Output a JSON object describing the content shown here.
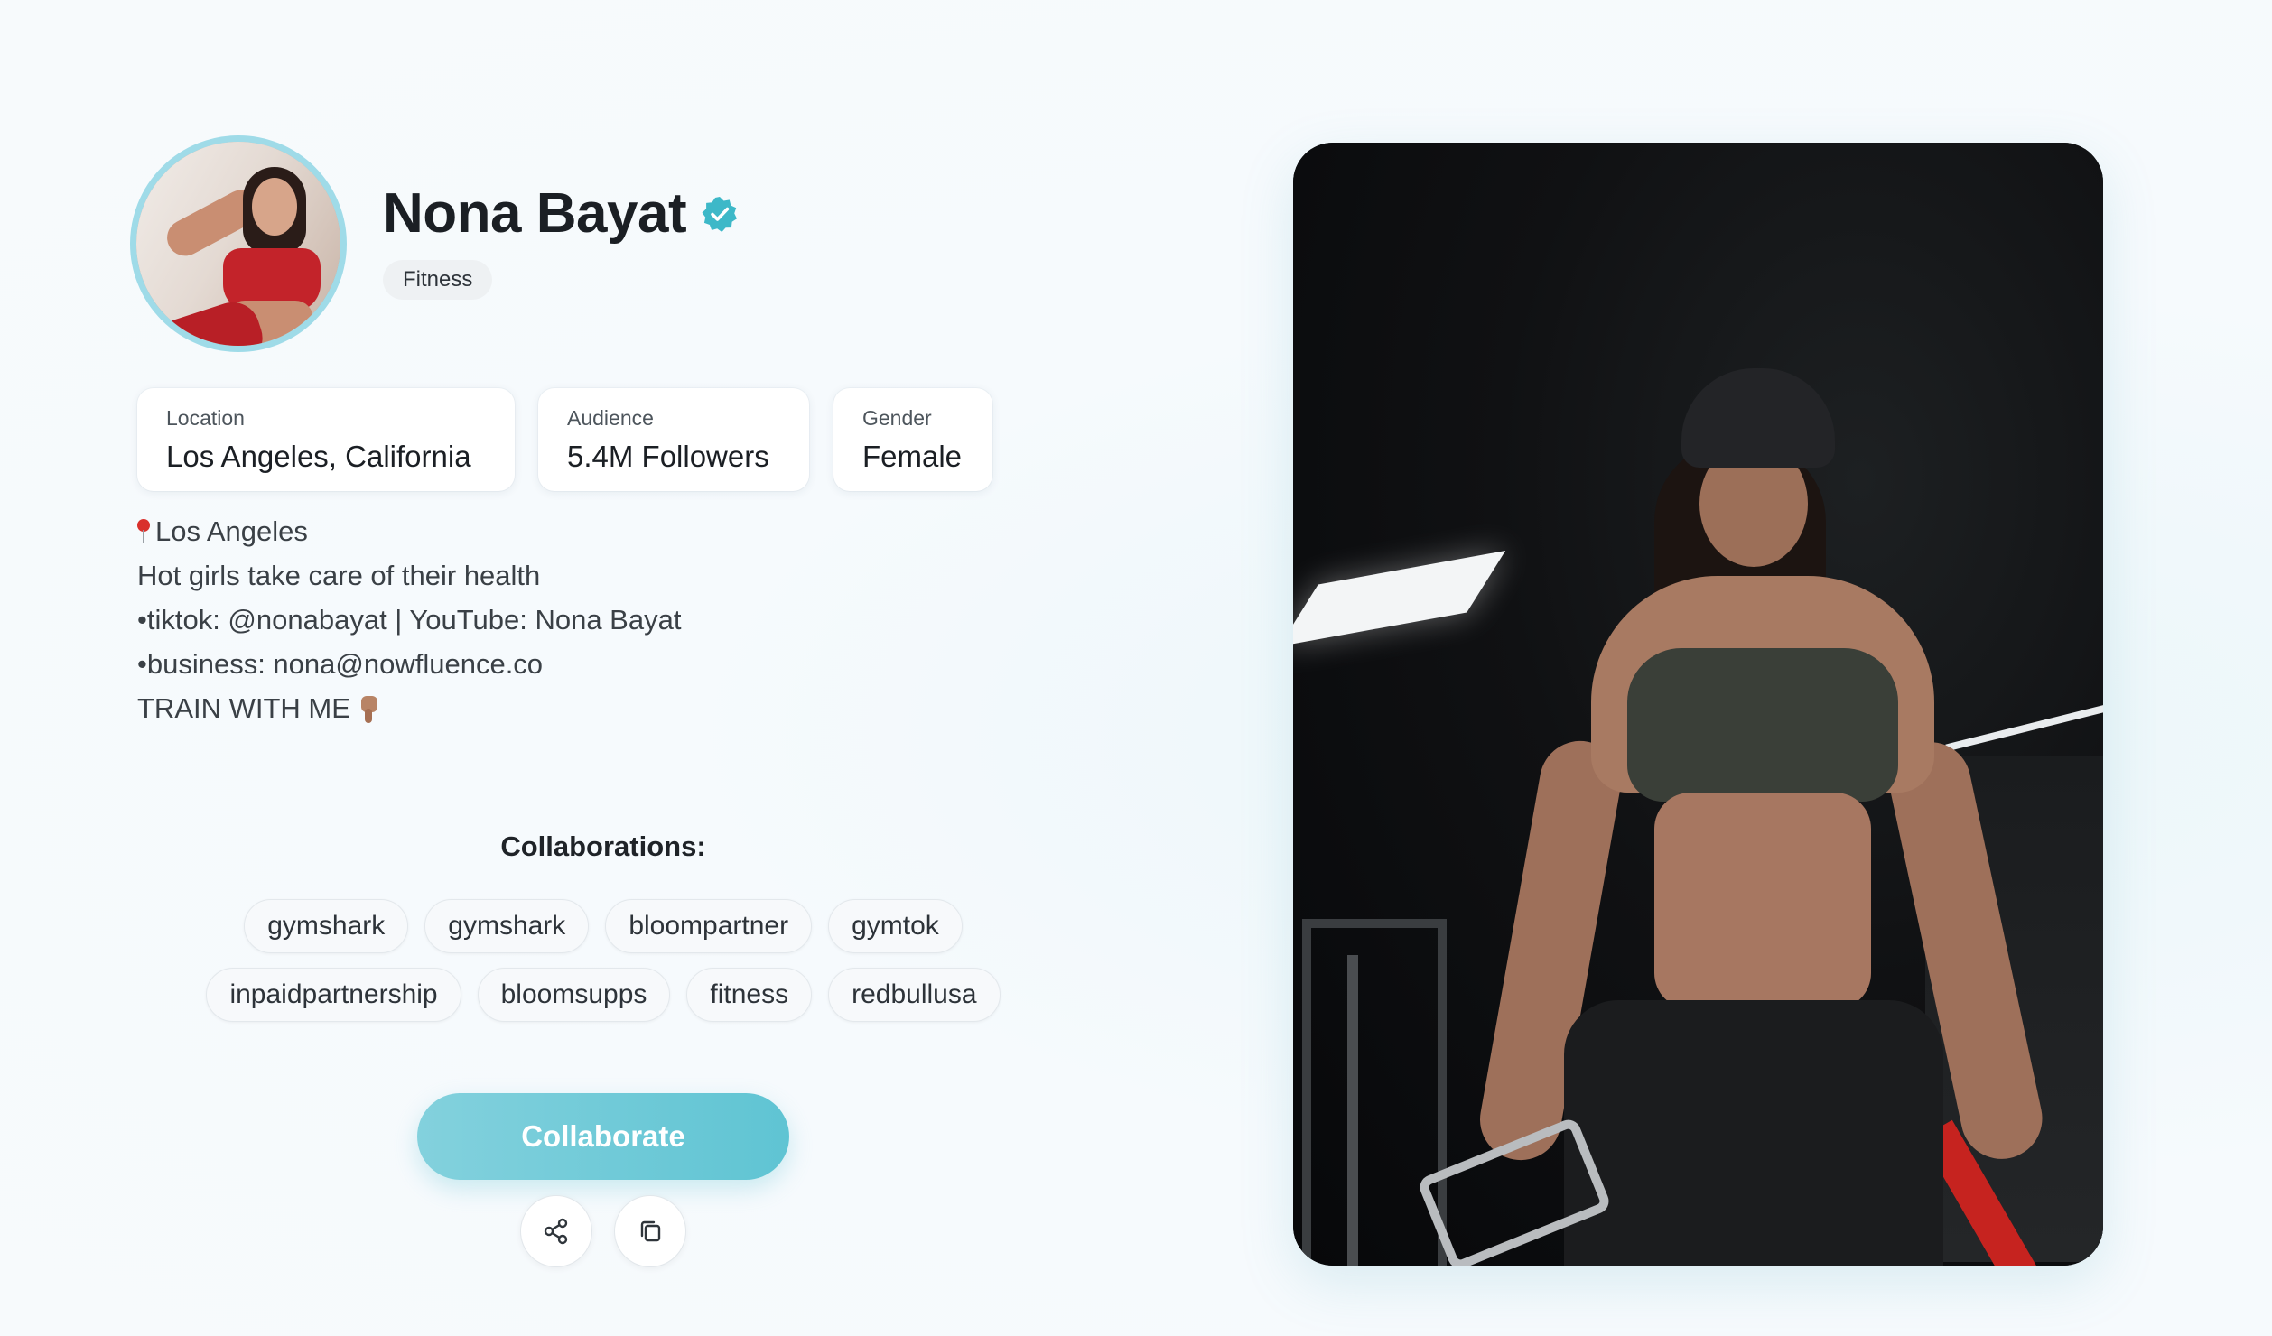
{
  "profile": {
    "name": "Nona Bayat",
    "verified": true,
    "category": "Fitness",
    "avatar": "avatar-photo"
  },
  "stats": {
    "location": {
      "label": "Location",
      "value": "Los Angeles, California"
    },
    "audience": {
      "label": "Audience",
      "value": "5.4M Followers"
    },
    "gender": {
      "label": "Gender",
      "value": "Female"
    }
  },
  "bio": {
    "lines": [
      "Los Angeles",
      "Hot girls take care of their health",
      "•tiktok: @nonabayat | YouTube: Nona Bayat",
      "•business: nona@nowfluence.co",
      "TRAIN WITH ME"
    ],
    "icons": {
      "line0": "round-pushpin-icon",
      "line4": "pointing-down-hand-icon"
    }
  },
  "collaborations": {
    "title": "Collaborations:",
    "row1": [
      "gymshark",
      "gymshark",
      "bloompartner",
      "gymtok"
    ],
    "row2": [
      "inpaidpartnership",
      "bloomsupps",
      "fitness",
      "redbullusa"
    ]
  },
  "actions": {
    "collaborate_label": "Collaborate",
    "share_icon": "share-icon",
    "copy_icon": "copy-icon"
  },
  "media": {
    "content": "profile-video-frame"
  },
  "colors": {
    "accent": "#5fc4d3",
    "verified_badge": "#3db8c8",
    "background": "#f6fafd",
    "avatar_ring": "#9fdbe8"
  }
}
